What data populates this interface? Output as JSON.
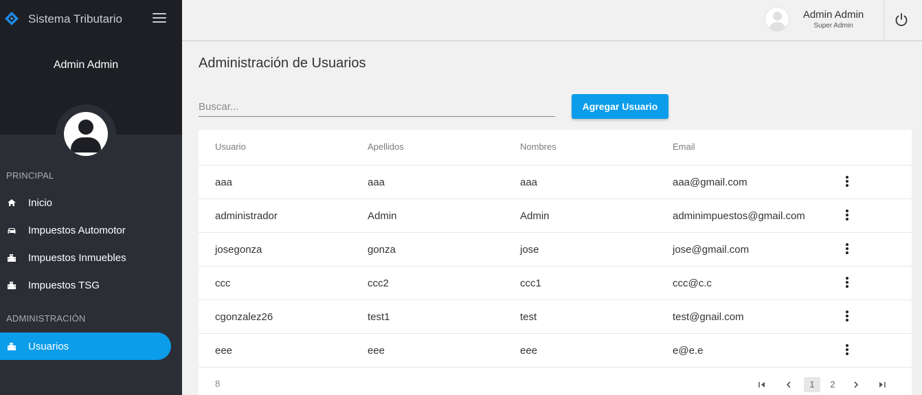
{
  "app": {
    "brand": "Sistema Tributario"
  },
  "sidebar": {
    "username": "Admin Admin",
    "sections": [
      {
        "label": "PRINCIPAL"
      },
      {
        "label": "ADMINISTRACIÓN"
      }
    ],
    "items": [
      {
        "label": "Inicio",
        "icon": "home-icon"
      },
      {
        "label": "Impuestos Automotor",
        "icon": "car-icon"
      },
      {
        "label": "Impuestos Inmuebles",
        "icon": "building-icon"
      },
      {
        "label": "Impuestos TSG",
        "icon": "building-icon"
      },
      {
        "label": "Usuarios",
        "icon": "building-icon",
        "active": true
      }
    ],
    "active_color": "#0b9cea"
  },
  "header": {
    "user_name": "Admin Admin",
    "user_role": "Super Admin"
  },
  "main": {
    "title": "Administración de Usuarios",
    "search": {
      "placeholder": "Buscar...",
      "value": ""
    },
    "add_button": "Agregar Usuario",
    "table": {
      "columns": [
        "Usuario",
        "Apellidos",
        "Nombres",
        "Email"
      ],
      "rows": [
        [
          "aaa",
          "aaa",
          "aaa",
          "aaa@gmail.com"
        ],
        [
          "administrador",
          "Admin",
          "Admin",
          "adminimpuestos@gmail.com"
        ],
        [
          "josegonza",
          "gonza",
          "jose",
          "jose@gmail.com"
        ],
        [
          "ccc",
          "ccc2",
          "ccc1",
          "ccc@c.c"
        ],
        [
          "cgonzalez26",
          "test1",
          "test",
          "test@gnail.com"
        ],
        [
          "eee",
          "eee",
          "eee",
          "e@e.e"
        ]
      ],
      "total": "8",
      "pages": [
        "1",
        "2"
      ],
      "current_page": "1"
    }
  }
}
